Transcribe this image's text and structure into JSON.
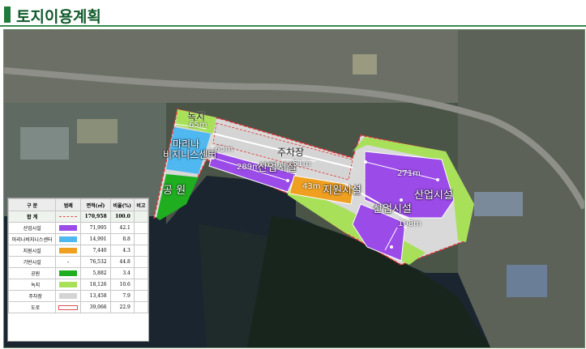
{
  "header": {
    "title": "토지이용계획"
  },
  "colors": {
    "industrial": "#9b4be8",
    "business_center": "#4fb8f0",
    "support": "#f0a020",
    "park": "#1fae20",
    "green": "#a8e05a",
    "parking": "#d4d4d4",
    "road": "#ffffff",
    "boundary": "#e03030",
    "water": "#1a2530",
    "land": "#4a5548"
  },
  "map": {
    "labels": {
      "green_top": "녹지",
      "marina_line1": "마리나",
      "marina_line2": "비지니스센터",
      "park": "공 원",
      "parking": "주차장",
      "industrial_left": "산업시설",
      "support": "지원시설",
      "industrial_right_top": "산업시설",
      "industrial_right_bottom": "산업시설"
    },
    "dimensions": {
      "d1": "65m",
      "d2": "65m",
      "d3": "289m",
      "d4": "51m",
      "d5": "43m",
      "d6": "271m",
      "d7": "108m"
    }
  },
  "legend": {
    "headers": [
      "구 분",
      "범례",
      "면적(㎡)",
      "비율(%)",
      "비고"
    ],
    "rows": [
      {
        "name": "합 계",
        "swatch": "total",
        "area": "170,958",
        "ratio": "100.0",
        "note": ""
      },
      {
        "name": "산업시설",
        "swatch": "industrial",
        "area": "71,995",
        "ratio": "42.1",
        "note": ""
      },
      {
        "name": "마리나비지니스센터",
        "swatch": "business_center",
        "area": "14,991",
        "ratio": "8.8",
        "note": ""
      },
      {
        "name": "지원시설",
        "swatch": "support",
        "area": "7,440",
        "ratio": "4.3",
        "note": ""
      },
      {
        "name": "기반시설",
        "swatch": "dash",
        "symbol": "-",
        "area": "76,532",
        "ratio": "44.8",
        "note": ""
      },
      {
        "name": "공원",
        "swatch": "park",
        "area": "5,882",
        "ratio": "3.4",
        "note": ""
      },
      {
        "name": "녹지",
        "swatch": "green",
        "area": "18,126",
        "ratio": "10.6",
        "note": ""
      },
      {
        "name": "주차장",
        "swatch": "parking",
        "area": "13,458",
        "ratio": "7.9",
        "note": ""
      },
      {
        "name": "도로",
        "swatch": "road",
        "area": "39,066",
        "ratio": "22.9",
        "note": ""
      }
    ]
  }
}
